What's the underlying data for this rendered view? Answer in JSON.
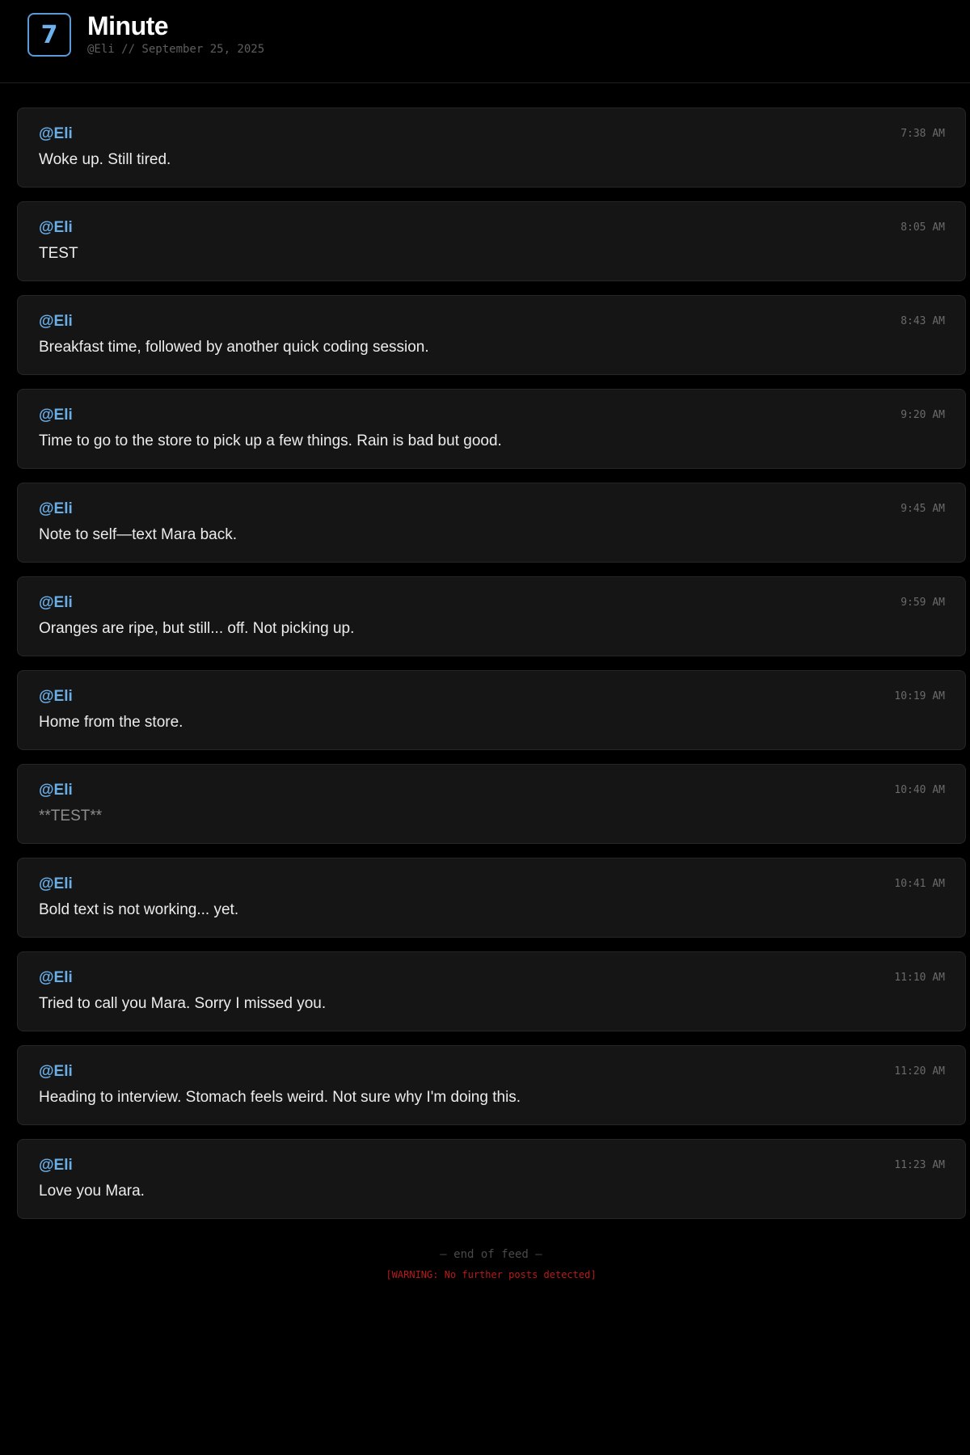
{
  "app": {
    "logo_text": "7",
    "title": "Minute",
    "subtitle": "@Eli // September 25, 2025"
  },
  "posts": [
    {
      "author": "@Eli",
      "time": "7:38 AM",
      "text": "Woke up. Still tired."
    },
    {
      "author": "@Eli",
      "time": "8:05 AM",
      "text": "TEST"
    },
    {
      "author": "@Eli",
      "time": "8:43 AM",
      "text": "Breakfast time, followed by another quick coding session."
    },
    {
      "author": "@Eli",
      "time": "9:20 AM",
      "text": "Time to go to the store to pick up a few things. Rain is bad but good."
    },
    {
      "author": "@Eli",
      "time": "9:45 AM",
      "text": "Note to self—text Mara back."
    },
    {
      "author": "@Eli",
      "time": "9:59 AM",
      "text": "Oranges are ripe, but still... off. Not picking up."
    },
    {
      "author": "@Eli",
      "time": "10:19 AM",
      "text": "Home from the store."
    },
    {
      "author": "@Eli",
      "time": "10:40 AM",
      "text": "**TEST**"
    },
    {
      "author": "@Eli",
      "time": "10:41 AM",
      "text": "Bold text is not working... yet."
    },
    {
      "author": "@Eli",
      "time": "11:10 AM",
      "text": "Tried to call you Mara. Sorry I missed you."
    },
    {
      "author": "@Eli",
      "time": "11:20 AM",
      "text": "Heading to interview. Stomach feels weird. Not sure why I'm doing this."
    },
    {
      "author": "@Eli",
      "time": "11:23 AM",
      "text": "Love you Mara."
    }
  ],
  "footer": {
    "end_text": "— end of feed —",
    "warning": "[WARNING: No further posts detected]"
  },
  "colors": {
    "background": "#000000",
    "card": "#151515",
    "accent": "#6aaee8",
    "warning": "#b81a1a"
  }
}
